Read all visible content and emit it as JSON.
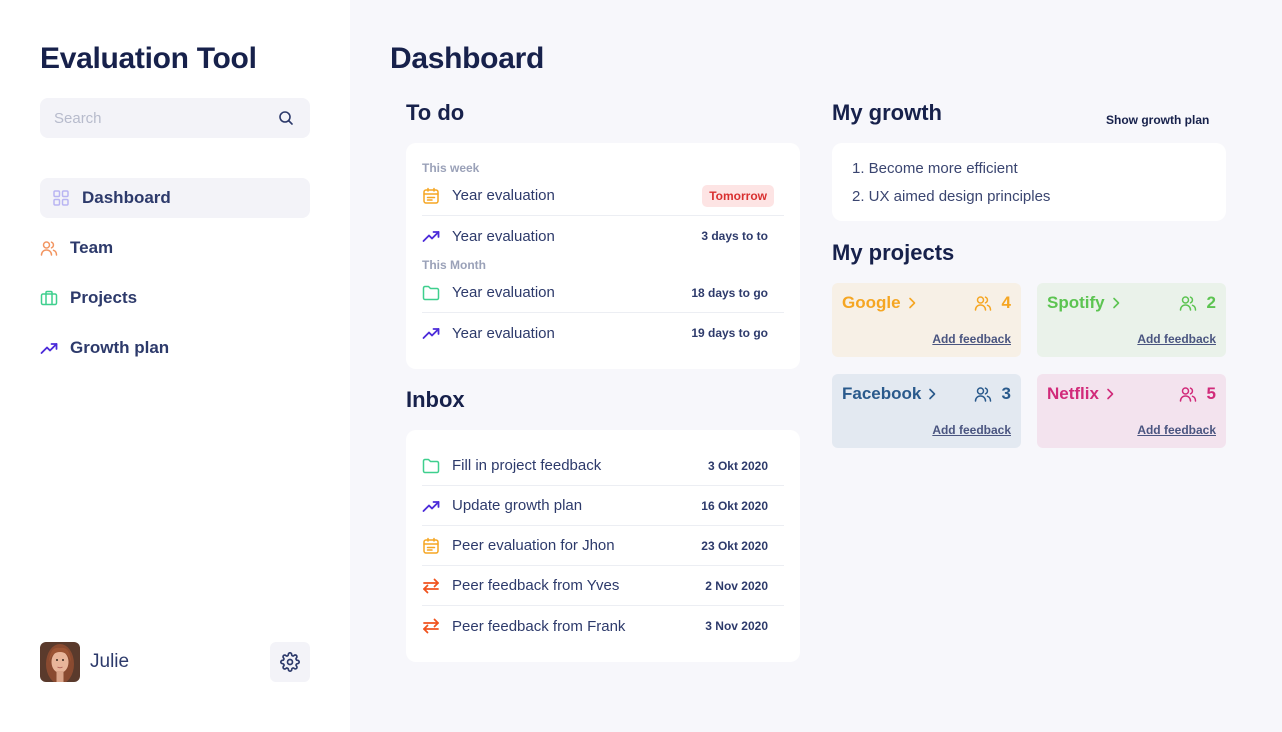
{
  "app": {
    "title": "Evaluation Tool"
  },
  "search": {
    "placeholder": "Search",
    "value": ""
  },
  "nav": {
    "items": [
      {
        "label": "Dashboard",
        "icon": "grid-icon",
        "active": true
      },
      {
        "label": "Team",
        "icon": "users-icon",
        "color": "#f29561"
      },
      {
        "label": "Projects",
        "icon": "briefcase-icon",
        "color": "#3ecf8e"
      },
      {
        "label": "Growth plan",
        "icon": "trending-up-icon",
        "color": "#4b2bd9"
      }
    ]
  },
  "user": {
    "name": "Julie"
  },
  "page": {
    "title": "Dashboard"
  },
  "todo": {
    "title": "To do",
    "this_week_label": "This week",
    "this_month_label": "This Month",
    "items": [
      {
        "label": "Year evaluation",
        "meta": "Tomorrow",
        "icon": "calendar-icon"
      },
      {
        "label": "Year evaluation",
        "meta": "3 days to to",
        "icon": "trending-up-icon"
      },
      {
        "label": "Year evaluation",
        "meta": "18 days to go",
        "icon": "folder-icon"
      },
      {
        "label": "Year evaluation",
        "meta": "19 days to go",
        "icon": "trending-up-icon"
      }
    ]
  },
  "inbox": {
    "title": "Inbox",
    "items": [
      {
        "label": "Fill in project feedback",
        "date": "3 Okt 2020",
        "icon": "folder-icon"
      },
      {
        "label": "Update growth plan",
        "date": "16 Okt 2020",
        "icon": "trending-up-icon"
      },
      {
        "label": "Peer evaluation for Jhon",
        "date": "23 Okt 2020",
        "icon": "calendar-icon"
      },
      {
        "label": "Peer feedback from Yves",
        "date": "2 Nov 2020",
        "icon": "swap-icon"
      },
      {
        "label": "Peer feedback from Frank",
        "date": "3 Nov 2020",
        "icon": "swap-icon"
      }
    ]
  },
  "growth": {
    "title": "My growth",
    "link": "Show growth plan",
    "items": [
      "1. Become more efficient",
      "2. UX aimed design principles"
    ]
  },
  "projects": {
    "title": "My projects",
    "feedback_label": "Add feedback",
    "items": [
      {
        "name": "Google",
        "count": "4",
        "color": "#f5a623",
        "bg": "#f7f0e6"
      },
      {
        "name": "Spotify",
        "count": "2",
        "color": "#5cc451",
        "bg": "#eaf2ea"
      },
      {
        "name": "Facebook",
        "count": "3",
        "color": "#2a5a8c",
        "bg": "#e3e9f1"
      },
      {
        "name": "Netflix",
        "count": "5",
        "color": "#d12a7a",
        "bg": "#f3e3ee"
      }
    ]
  }
}
